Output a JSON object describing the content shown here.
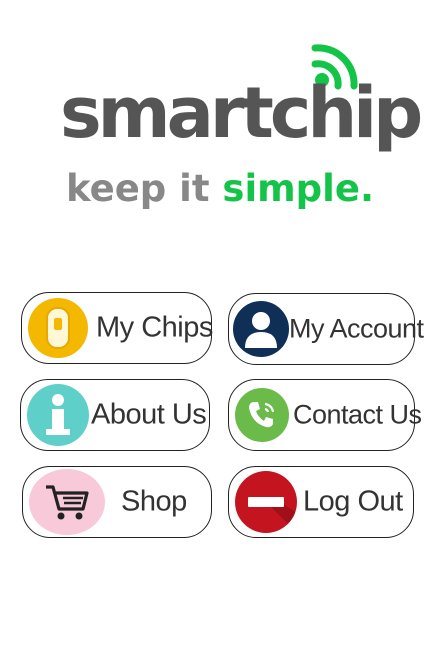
{
  "brand": {
    "logo_text": "smartchip",
    "tagline_part1": "keep it",
    "tagline_part2": "simple.",
    "colors": {
      "logo_gray": "#555555",
      "tagline_gray": "#888888",
      "accent_green": "#13c448"
    }
  },
  "menu": {
    "my_chips": {
      "label": "My Chips",
      "icon": "chip-icon",
      "color": "#f5b800"
    },
    "my_account": {
      "label": "My Account",
      "icon": "user-icon",
      "color": "#0f2f57"
    },
    "about_us": {
      "label": "About Us",
      "icon": "info-icon",
      "color": "#5fcfc9"
    },
    "contact_us": {
      "label": "Contact Us",
      "icon": "phone-icon",
      "color": "#6abb4a"
    },
    "shop": {
      "label": "Shop",
      "icon": "cart-icon",
      "color": "#f8c9d8"
    },
    "log_out": {
      "label": "Log Out",
      "icon": "minus-icon",
      "color": "#c41420"
    }
  }
}
